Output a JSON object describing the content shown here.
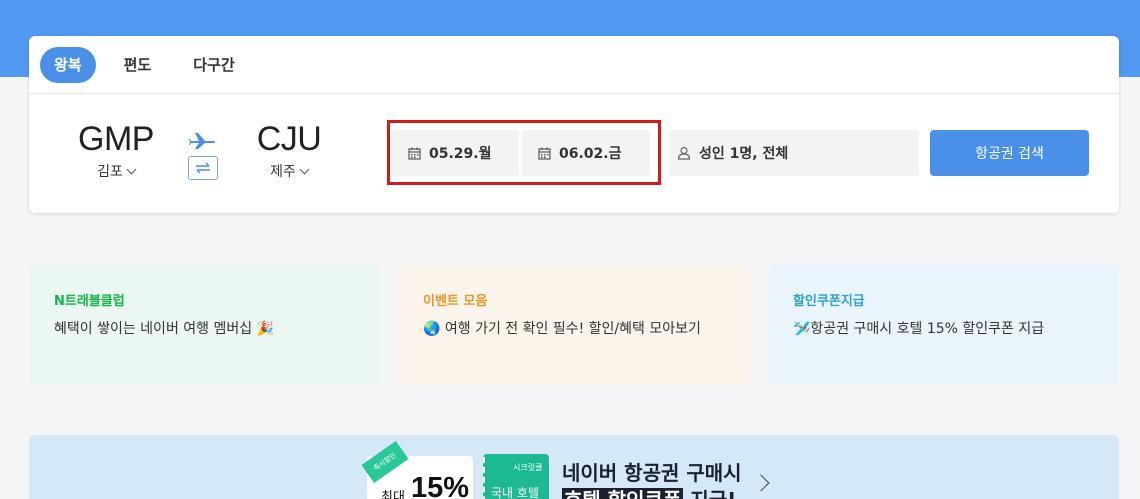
{
  "tabs": [
    {
      "label": "왕복",
      "active": true
    },
    {
      "label": "편도",
      "active": false
    },
    {
      "label": "다구간",
      "active": false
    }
  ],
  "route": {
    "departure": {
      "code": "GMP",
      "city": "김포"
    },
    "arrival": {
      "code": "CJU",
      "city": "제주"
    }
  },
  "dates": {
    "departure": "05.29.월",
    "return": "06.02.금"
  },
  "passengers": "성인 1명, 전체",
  "search_button": "항공권 검색",
  "promos": [
    {
      "title": "N트래블클럽",
      "text": "혜택이 쌓이는 네이버 여행 멤버십 🎉"
    },
    {
      "title": "이벤트 모음",
      "text": "🌏 여행 가기 전 확인 필수! 할인/혜택 모아보기"
    },
    {
      "title": "할인쿠폰지급",
      "text": "🛩️항공권 구매시 호텔 15% 할인쿠폰 지급"
    }
  ],
  "banner": {
    "tag": "즉시할인",
    "max_label": "최대",
    "percent": "15%",
    "ticket_small": "시크릿쿨",
    "ticket_label": "국내 호텔",
    "line1": "네이버 항공권 구매시",
    "line2_highlight": "호텔 할인쿠폰",
    "line2_rest": " 지급!"
  },
  "colors": {
    "accent": "#4a90e8",
    "header_band": "#5098f2",
    "highlight_border": "#d11a1a"
  }
}
